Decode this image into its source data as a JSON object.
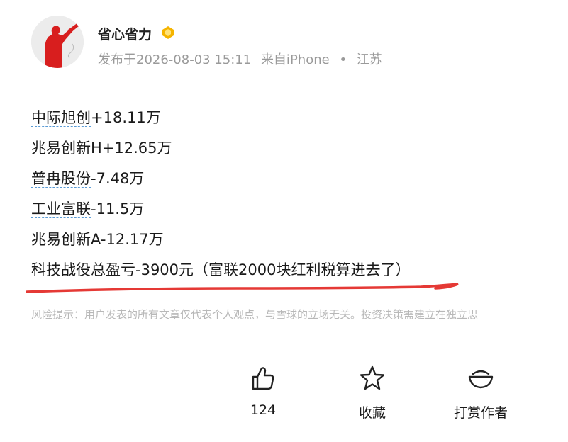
{
  "author": {
    "name": "省心省力",
    "badge_icon": "vip-badge-icon",
    "avatar_icon": "avatar-silhouette-icon"
  },
  "meta": {
    "published": "发布于2026-08-03 15:11",
    "source": "来自iPhone",
    "separator": "•",
    "location": "江苏"
  },
  "post": {
    "lines": [
      {
        "stock": "中际旭创",
        "change": "+18.11万"
      },
      {
        "stock": "兆易创新H",
        "change": "+12.65万"
      },
      {
        "stock": "普冉股份",
        "change": "-7.48万"
      },
      {
        "stock": "工业富联",
        "change": "-11.5万"
      },
      {
        "stock": "兆易创新A",
        "change": "-12.17万"
      }
    ],
    "summary": "科技战役总盈亏-3900元（富联2000块红利税算进去了）"
  },
  "risk_notice": "风险提示：用户发表的所有文章仅代表个人观点，与雪球的立场无关。投资决策需建立在独立思",
  "actions": {
    "like_count": "124",
    "favorite_label": "收藏",
    "tip_label": "打赏作者"
  },
  "colors": {
    "accent_red": "#e53935",
    "link_underline": "#5b9bd5",
    "meta_gray": "#9a9a9a",
    "risk_gray": "#b8b8b8",
    "badge_gold": "#f5b400"
  }
}
